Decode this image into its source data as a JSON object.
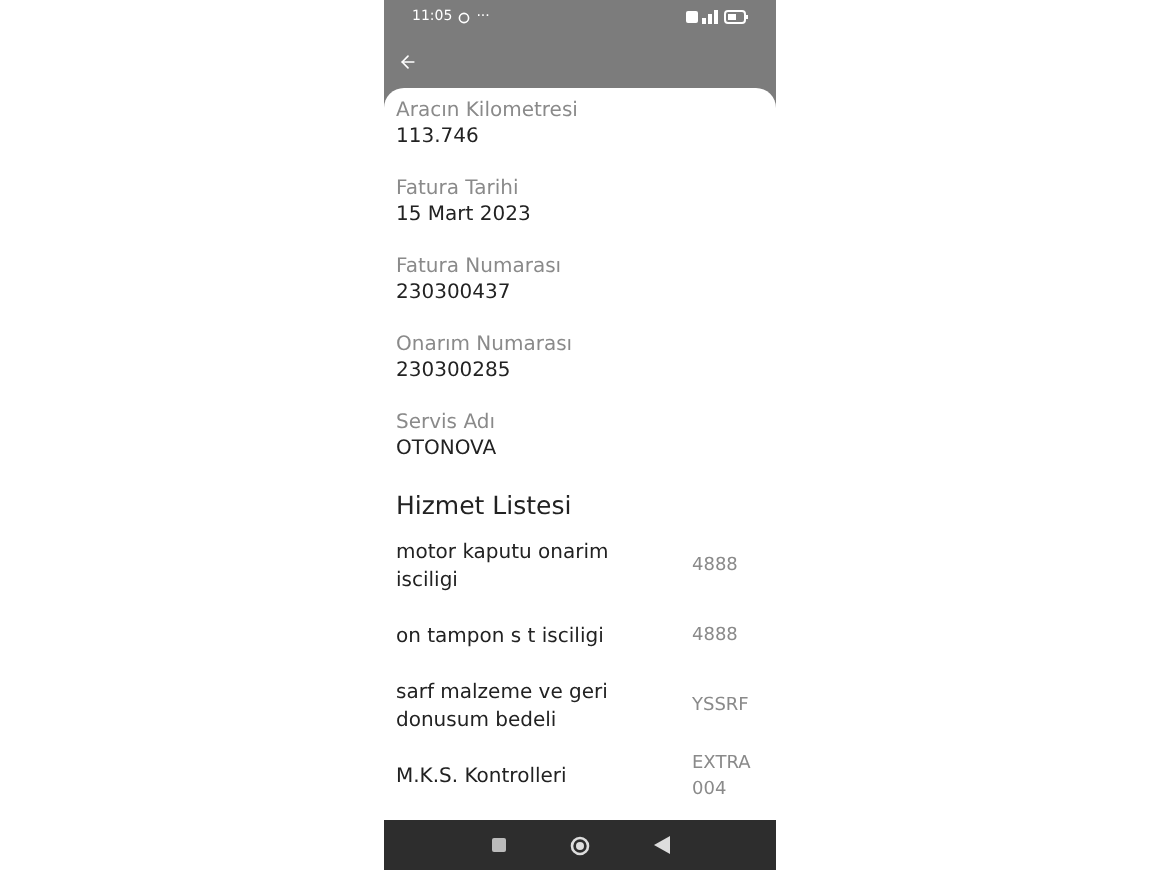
{
  "status_bar": {
    "time": "11:05",
    "more": "···"
  },
  "fields": [
    {
      "label": "Aracın Kilometresi",
      "value": "113.746"
    },
    {
      "label": "Fatura Tarihi",
      "value": "15 Mart 2023"
    },
    {
      "label": "Fatura Numarası",
      "value": "230300437"
    },
    {
      "label": "Onarım Numarası",
      "value": "230300285"
    },
    {
      "label": "Servis Adı",
      "value": "OTONOVA"
    }
  ],
  "service_list": {
    "title": "Hizmet Listesi",
    "items": [
      {
        "name": "motor kaputu onarim isciligi",
        "code": "4888"
      },
      {
        "name": "on tampon s t isciligi",
        "code": "4888"
      },
      {
        "name": "sarf malzeme ve geri donusum bedeli",
        "code": "YSSRF"
      },
      {
        "name": "M.K.S. Kontrolleri",
        "code": "EXTRA 004"
      }
    ]
  }
}
